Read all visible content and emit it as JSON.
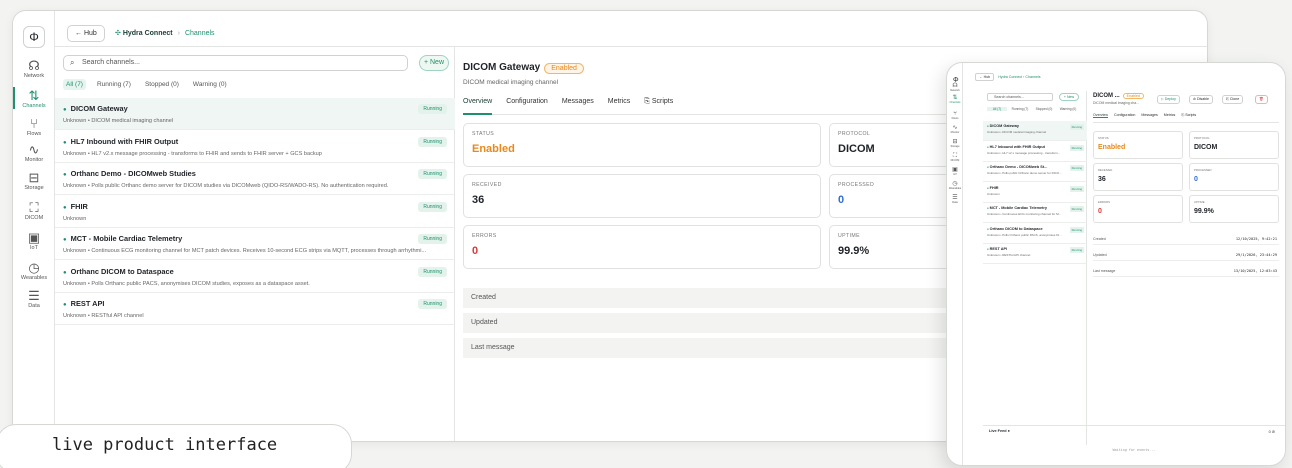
{
  "nav": [
    {
      "icon": "network-icon",
      "glyph": "☊",
      "label": "Network"
    },
    {
      "icon": "channels-icon",
      "glyph": "⇅",
      "label": "Channels"
    },
    {
      "icon": "flows-icon",
      "glyph": "⑂",
      "label": "Flows"
    },
    {
      "icon": "monitor-icon",
      "glyph": "∿",
      "label": "Monitor"
    },
    {
      "icon": "storage-icon",
      "glyph": "⊟",
      "label": "Storage"
    },
    {
      "icon": "dicom-icon",
      "glyph": "⛶",
      "label": "DICOM"
    },
    {
      "icon": "iot-icon",
      "glyph": "▣",
      "label": "IoT"
    },
    {
      "icon": "wearables-icon",
      "glyph": "◷",
      "label": "Wearables"
    },
    {
      "icon": "data-icon",
      "glyph": "☰",
      "label": "Data"
    }
  ],
  "breadcrumb": {
    "hub": "← Hub",
    "app": "Hydra Connect",
    "current": "Channels",
    "sep": "›"
  },
  "search": {
    "placeholder": "Search channels...",
    "icon": "⌕"
  },
  "new_label": "+ New",
  "filters": [
    "All (7)",
    "Running (7)",
    "Stopped (0)",
    "Warning (0)"
  ],
  "channels": [
    {
      "name": "DICOM Gateway",
      "desc": "Unknown • DICOM medical imaging channel",
      "status": "Running"
    },
    {
      "name": "HL7 Inbound with FHIR Output",
      "desc": "Unknown • HL7 v2.x message processing - transforms to FHIR and sends to FHIR server + GCS backup",
      "status": "Running"
    },
    {
      "name": "Orthanc Demo - DICOMweb Studies",
      "desc": "Unknown • Polls public Orthanc demo server for DICOM studies via DICOMweb (QIDO-RS/WADO-RS). No authentication required.",
      "status": "Running"
    },
    {
      "name": "FHIR",
      "desc": "Unknown",
      "status": "Running"
    },
    {
      "name": "MCT - Mobile Cardiac Telemetry",
      "desc": "Unknown • Continuous ECG monitoring channel for MCT patch devices. Receives 10-second ECG strips via MQTT, processes through arrhythmi...",
      "status": "Running"
    },
    {
      "name": "Orthanc DICOM to Dataspace",
      "desc": "Unknown • Polls Orthanc public PACS, anonymises DICOM studies, exposes as a dataspace asset.",
      "status": "Running"
    },
    {
      "name": "REST API",
      "desc": "Unknown • RESTful API channel",
      "status": "Running"
    }
  ],
  "detail": {
    "title": "DICOM Gateway",
    "badge": "Enabled",
    "subtitle": "DICOM medical imaging channel",
    "tabs": [
      "Overview",
      "Configuration",
      "Messages",
      "Metrics",
      "⎘ Scripts"
    ],
    "cards": [
      {
        "label": "STATUS",
        "value": "Enabled",
        "color": "#e8891b"
      },
      {
        "label": "PROTOCOL",
        "value": "DICOM",
        "color": "#1f2328"
      },
      {
        "label": "RECEIVED",
        "value": "36",
        "color": "#1f2328"
      },
      {
        "label": "PROCESSED",
        "value": "0",
        "color": "#2f6fd6"
      },
      {
        "label": "ERRORS",
        "value": "0",
        "color": "#d93a3a"
      },
      {
        "label": "UPTIME",
        "value": "99.9%",
        "color": "#1f2328"
      }
    ],
    "rows": [
      {
        "label": "Created",
        "value": "12/10/2025, 9:42:21"
      },
      {
        "label": "Updated",
        "value": "29/1/2026, 23:44:29"
      },
      {
        "label": "Last message",
        "value": "13/10/2025, 12:03:43"
      }
    ]
  },
  "tablet": {
    "title": "DICOM ...",
    "filters": [
      "All (7)",
      "Running (7)",
      "Stopped (0)",
      "Warning (0)"
    ],
    "subtitle": "DICOM medical imaging cha...",
    "buttons": [
      "▷ Deploy",
      "⊘ Disable",
      "⎘ Clone",
      "🗑"
    ],
    "channels": [
      {
        "name": "DICOM Gateway",
        "desc": "Unknown • DICOM medical imaging channel"
      },
      {
        "name": "HL7 Inbound with FHIR Output",
        "desc": "Unknown • HL7 v2.x message processing - transform..."
      },
      {
        "name": "Orthanc Demo - DICOMweb St...",
        "desc": "Unknown • Polls public Orthanc demo server for DICO..."
      },
      {
        "name": "FHIR",
        "desc": "Unknown"
      },
      {
        "name": "MCT - Mobile Cardiac Telemetry",
        "desc": "Unknown • Continuous ECG monitoring channel for M..."
      },
      {
        "name": "Orthanc DICOM to Dataspace",
        "desc": "Unknown • Polls Orthanc public PACS, anonymises Di..."
      },
      {
        "name": "REST API",
        "desc": "Unknown • RESTful API channel"
      }
    ],
    "live_feed": "Live Feed ●",
    "waiting": "Waiting for events...",
    "count": "0 ⊘"
  },
  "caption": "live product interface"
}
